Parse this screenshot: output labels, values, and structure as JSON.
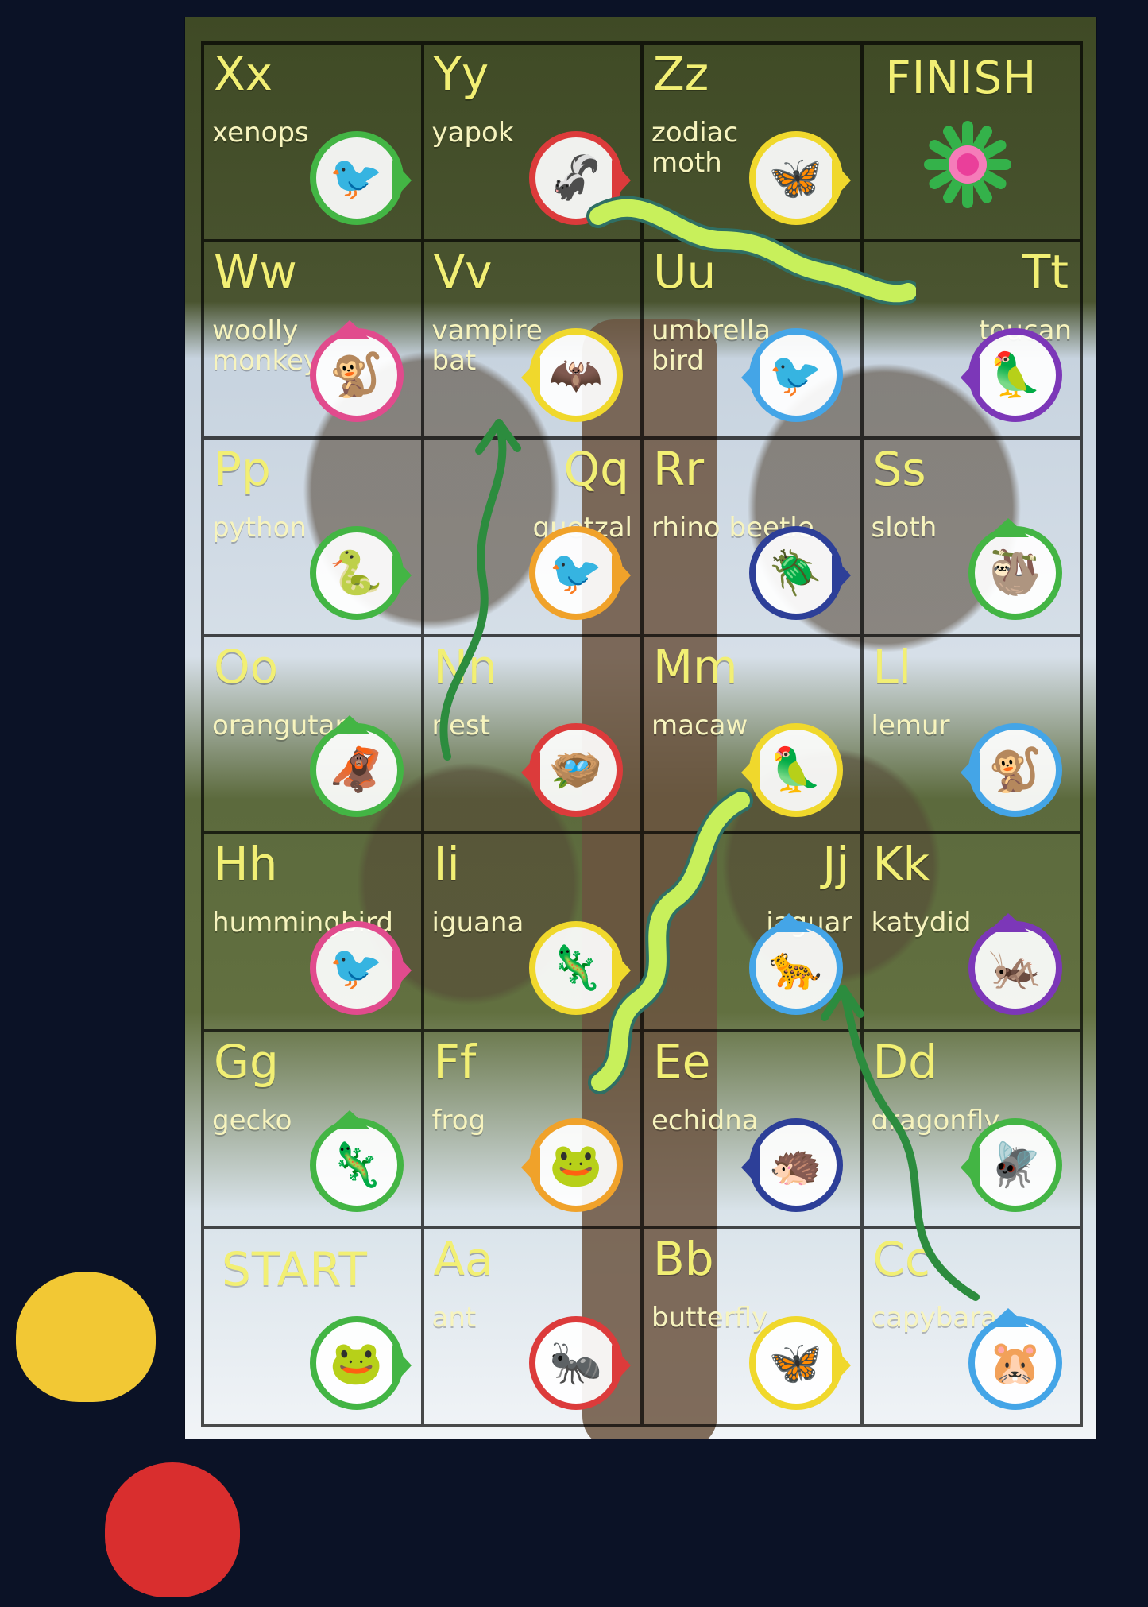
{
  "board": {
    "cells": [
      {
        "letter": "Xx",
        "word": "xenops",
        "ring": "#43b544",
        "arrow": "right",
        "icon": "bird-icon"
      },
      {
        "letter": "Yy",
        "word": "yapok",
        "ring": "#dc3b3b",
        "arrow": "right",
        "icon": "possum-icon"
      },
      {
        "letter": "Zz",
        "word": "zodiac\nmoth",
        "ring": "#f0d82c",
        "arrow": "right",
        "icon": "moth-icon"
      },
      {
        "finish": "FINISH",
        "icon": "flower-icon"
      },
      {
        "letter": "Ww",
        "word": "woolly\nmonkey",
        "ring": "#e14b8d",
        "arrow": "up",
        "icon": "monkey-icon"
      },
      {
        "letter": "Vv",
        "word": "vampire\nbat",
        "ring": "#f0d82c",
        "arrow": "left",
        "icon": "bat-icon"
      },
      {
        "letter": "Uu",
        "word": "umbrella\nbird",
        "ring": "#44a5e7",
        "arrow": "left",
        "icon": "umbrella-bird-icon"
      },
      {
        "letter": "Tt",
        "word": "toucan",
        "ring": "#7c37b8",
        "arrow": "left",
        "icon": "toucan-icon",
        "right": true
      },
      {
        "letter": "Pp",
        "word": "python",
        "ring": "#43b544",
        "arrow": "right",
        "icon": "python-icon"
      },
      {
        "letter": "Qq",
        "word": "quetzal",
        "ring": "#f0a22a",
        "arrow": "right",
        "icon": "quetzal-icon",
        "right": true
      },
      {
        "letter": "Rr",
        "word": "rhino beetle",
        "ring": "#2d3f98",
        "arrow": "right",
        "icon": "beetle-icon"
      },
      {
        "letter": "Ss",
        "word": "sloth",
        "ring": "#43b544",
        "arrow": "up",
        "icon": "sloth-icon"
      },
      {
        "letter": "Oo",
        "word": "orangutan",
        "ring": "#43b544",
        "arrow": "up",
        "icon": "orangutan-icon"
      },
      {
        "letter": "Nn",
        "word": "nest",
        "ring": "#dc3b3b",
        "arrow": "left",
        "icon": "nest-icon"
      },
      {
        "letter": "Mm",
        "word": "macaw",
        "ring": "#f0d82c",
        "arrow": "left",
        "icon": "macaw-icon"
      },
      {
        "letter": "Ll",
        "word": "lemur",
        "ring": "#44a5e7",
        "arrow": "left",
        "icon": "lemur-icon"
      },
      {
        "letter": "Hh",
        "word": "hummingbird",
        "ring": "#e14b8d",
        "arrow": "right",
        "icon": "hummingbird-icon"
      },
      {
        "letter": "Ii",
        "word": "iguana",
        "ring": "#f0d82c",
        "arrow": "right",
        "icon": "iguana-icon"
      },
      {
        "letter": "Jj",
        "word": "jaguar",
        "ring": "#44a5e7",
        "arrow": "up",
        "icon": "jaguar-icon",
        "right": true
      },
      {
        "letter": "Kk",
        "word": "katydid",
        "ring": "#7c37b8",
        "arrow": "up",
        "icon": "katydid-icon"
      },
      {
        "letter": "Gg",
        "word": "gecko",
        "ring": "#43b544",
        "arrow": "up",
        "icon": "gecko-icon"
      },
      {
        "letter": "Ff",
        "word": "frog",
        "ring": "#f0a22a",
        "arrow": "left",
        "icon": "frog-icon"
      },
      {
        "letter": "Ee",
        "word": "echidna",
        "ring": "#2d3f98",
        "arrow": "left",
        "icon": "echidna-icon"
      },
      {
        "letter": "Dd",
        "word": "dragonfly",
        "ring": "#43b544",
        "arrow": "left",
        "icon": "dragonfly-icon"
      },
      {
        "start": "START",
        "ring": "#43b544",
        "arrow": "right",
        "icon": "green-frog-icon"
      },
      {
        "letter": "Aa",
        "word": "ant",
        "ring": "#dc3b3b",
        "arrow": "right",
        "icon": "ant-icon"
      },
      {
        "letter": "Bb",
        "word": "butterfly",
        "ring": "#f0d82c",
        "arrow": "right",
        "icon": "butterfly-icon"
      },
      {
        "letter": "Cc",
        "word": "capybara",
        "ring": "#44a5e7",
        "arrow": "up",
        "icon": "capybara-icon"
      }
    ]
  },
  "tokens": [
    {
      "color": "#f2c834",
      "icon": "yellow-frog-token-icon"
    },
    {
      "color": "#d92e2e",
      "icon": "red-frog-token-icon"
    }
  ]
}
